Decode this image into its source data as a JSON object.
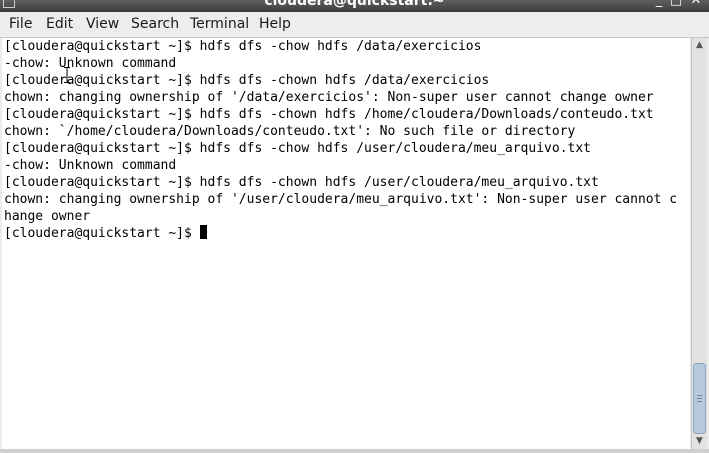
{
  "window": {
    "title": "cloudera@quickstart:~",
    "minimize": "_",
    "maximize": "□",
    "close": "✕"
  },
  "menubar": {
    "items": [
      "File",
      "Edit",
      "View",
      "Search",
      "Terminal",
      "Help"
    ]
  },
  "terminal": {
    "lines": [
      "[cloudera@quickstart ~]$ hdfs dfs -chow hdfs /data/exercicios",
      "-chow: Unknown command",
      "[cloudera@quickstart ~]$ hdfs dfs -chown hdfs /data/exercicios",
      "chown: changing ownership of '/data/exercicios': Non-super user cannot change owner",
      "[cloudera@quickstart ~]$ hdfs dfs -chown hdfs /home/cloudera/Downloads/conteudo.txt",
      "chown: `/home/cloudera/Downloads/conteudo.txt': No such file or directory",
      "[cloudera@quickstart ~]$ hdfs dfs -chow hdfs /user/cloudera/meu_arquivo.txt",
      "-chow: Unknown command",
      "[cloudera@quickstart ~]$ hdfs dfs -chown hdfs /user/cloudera/meu_arquivo.txt",
      "chown: changing ownership of '/user/cloudera/meu_arquivo.txt': Non-super user cannot c",
      "hange owner"
    ],
    "prompt": "[cloudera@quickstart ~]$ "
  },
  "scrollbar": {
    "up_icon": "arrow-up-icon",
    "down_icon": "arrow-down-icon",
    "position_fraction": 0.9
  }
}
